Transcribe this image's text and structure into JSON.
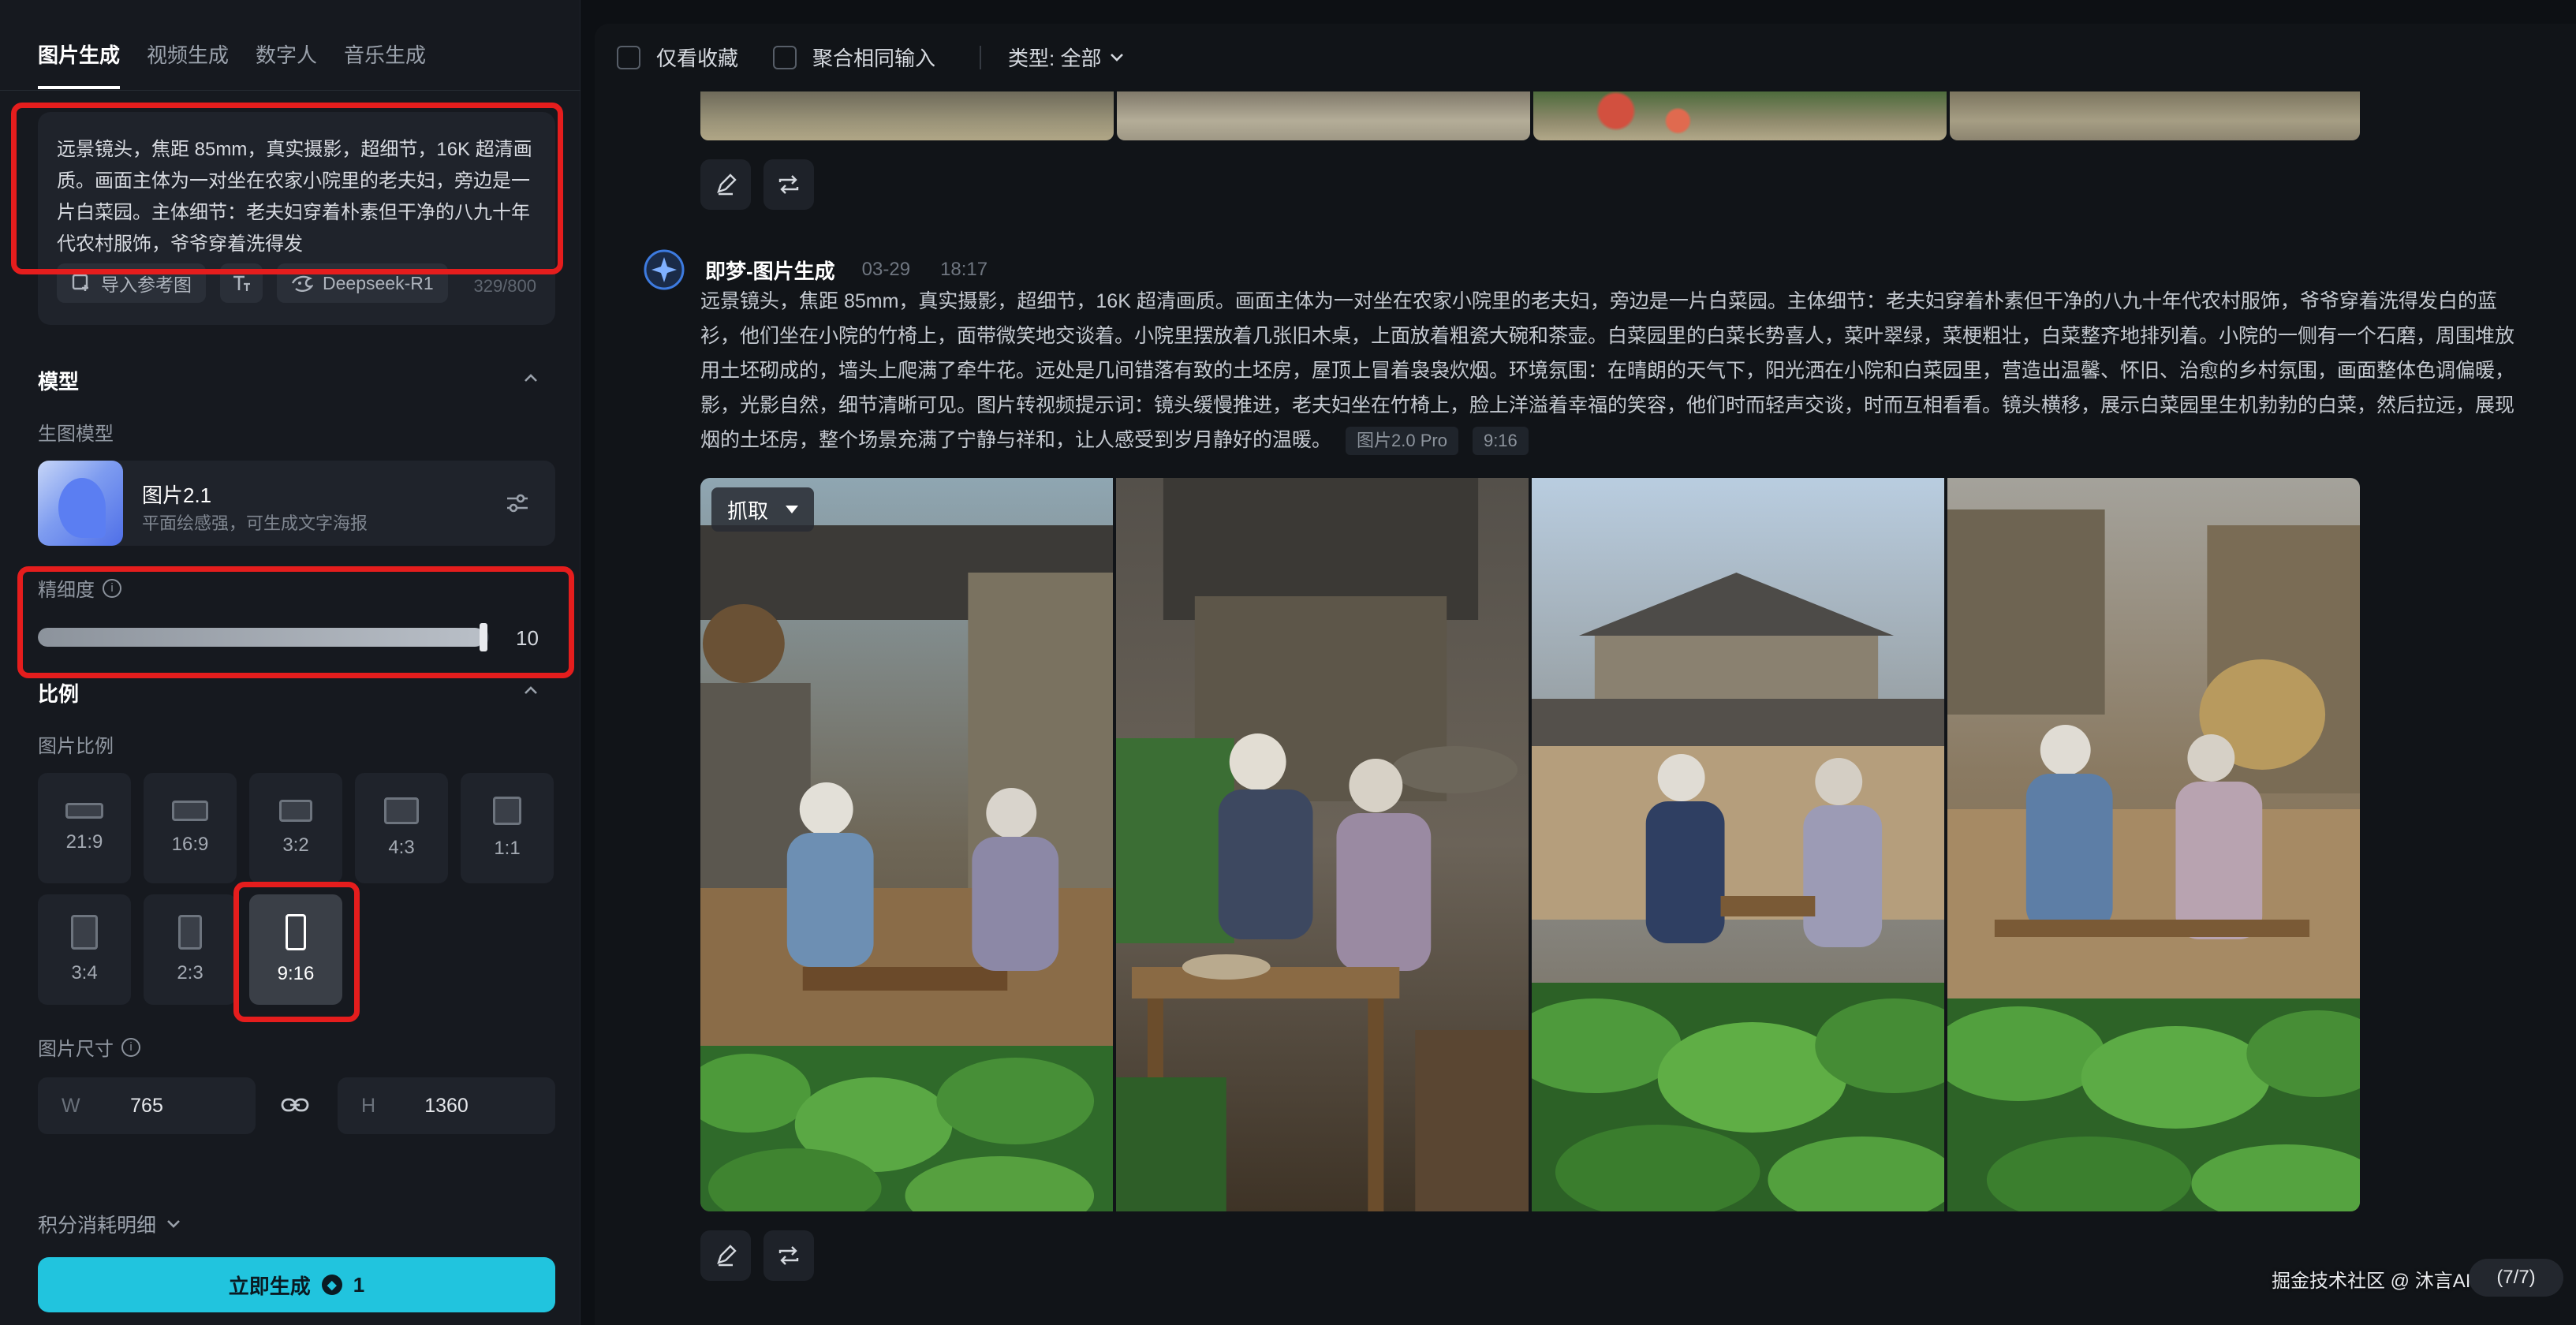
{
  "sidebar": {
    "tabs": [
      "图片生成",
      "视频生成",
      "数字人",
      "音乐生成"
    ],
    "prompt": {
      "text": "远景镜头，焦距 85mm，真实摄影，超细节，16K 超清画质。画面主体为一对坐在农家小院里的老夫妇，旁边是一片白菜园。主体细节：老夫妇穿着朴素但干净的八九十年代农村服饰，爷爷穿着洗得发",
      "import_ref_label": "导入参考图",
      "model_chip_label": "Deepseek-R1",
      "char_count": "329/800"
    },
    "model_section": {
      "title": "模型",
      "sub_label": "生图模型",
      "model_name": "图片2.1",
      "model_desc": "平面绘感强，可生成文字海报"
    },
    "detail": {
      "label": "精细度",
      "value": 10,
      "value_label": "10",
      "fill_fraction": 0.99
    },
    "ratio_section": {
      "title": "比例",
      "sub_label": "图片比例",
      "options": [
        "21:9",
        "16:9",
        "3:2",
        "4:3",
        "1:1",
        "3:4",
        "2:3",
        "9:16"
      ],
      "selected": "9:16"
    },
    "size": {
      "label": "图片尺寸",
      "w_letter": "W",
      "w_value": "765",
      "h_letter": "H",
      "h_value": "1360"
    },
    "credits_label": "积分消耗明细",
    "generate": {
      "label": "立即生成",
      "cost": "1"
    }
  },
  "main": {
    "filters": {
      "favorites_label": "仅看收藏",
      "merge_label": "聚合相同输入",
      "type_label": "类型: 全部"
    },
    "generation": {
      "title": "即梦-图片生成",
      "date": "03-29",
      "time": "18:17",
      "prompt_lines": [
        "远景镜头，焦距 85mm，真实摄影，超细节，16K 超清画质。画面主体为一对坐在农家小院里的老夫妇，旁边是一片白菜园。主体细节：老夫妇穿着朴素但干净的八九十年代农村服饰，爷爷穿着洗得发白的蓝",
        "衫，他们坐在小院的竹椅上，面带微笑地交谈着。小院里摆放着几张旧木桌，上面放着粗瓷大碗和茶壶。白菜园里的白菜长势喜人，菜叶翠绿，菜梗粗壮，白菜整齐地排列着。小院的一侧有一个石磨，周围堆放",
        "用土坯砌成的，墙头上爬满了牵牛花。远处是几间错落有致的土坯房，屋顶上冒着袅袅炊烟。环境氛围：在晴朗的天气下，阳光洒在小院和白菜园里，营造出温馨、怀旧、治愈的乡村氛围，画面整体色调偏暖，",
        "影，光影自然，细节清晰可见。图片转视频提示词：镜头缓慢推进，老夫妇坐在竹椅上，脸上洋溢着幸福的笑容，他们时而轻声交谈，时而互相看看。镜头横移，展示白菜园里生机勃勃的白菜，然后拉远，展现",
        "烟的土坯房，整个场景充满了宁静与祥和，让人感受到岁月静好的温暖。"
      ],
      "tags": [
        "图片2.0 Pro",
        "9:16"
      ],
      "grab_label": "抓取"
    },
    "watermark": "掘金技术社区 @ 沐言AIGC创作",
    "pager": "(7/7)"
  },
  "colors": {
    "accent": "#21c4de",
    "highlight": "#e51d1d"
  }
}
